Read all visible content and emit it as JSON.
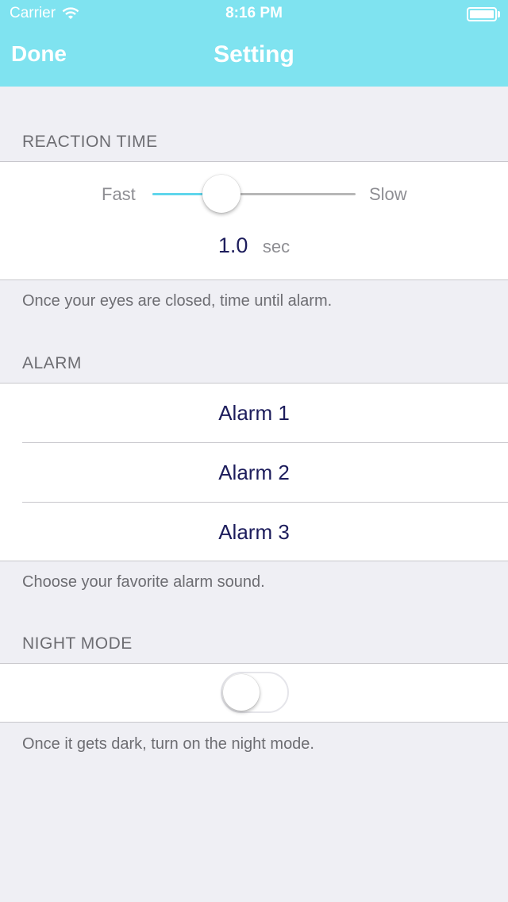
{
  "status_bar": {
    "carrier": "Carrier",
    "time": "8:16 PM"
  },
  "nav": {
    "done_label": "Done",
    "title": "Setting",
    "bar_color": "#7fe3f0"
  },
  "reaction_time": {
    "header": "REACTION TIME",
    "slider_min_label": "Fast",
    "slider_max_label": "Slow",
    "slider_level": 0.34,
    "value": "1.0",
    "unit": "sec",
    "footer": "Once your eyes are closed, time until alarm."
  },
  "alarm": {
    "header": "ALARM",
    "options": [
      "Alarm 1",
      "Alarm 2",
      "Alarm 3"
    ],
    "footer": "Choose your favorite alarm sound."
  },
  "night_mode": {
    "header": "NIGHT MODE",
    "enabled": false,
    "footer": "Once it gets dark, turn on the night mode."
  }
}
